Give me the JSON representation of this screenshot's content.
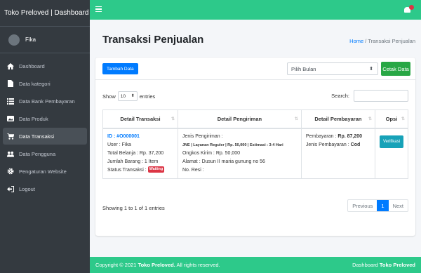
{
  "sidebar": {
    "brand": "Toko Preloved | Dashboard",
    "user_name": "Fika",
    "items": [
      {
        "label": "Dashboard",
        "icon": "home-icon"
      },
      {
        "label": "Data kategori",
        "icon": "file-icon"
      },
      {
        "label": "Data Bank Pembayaran",
        "icon": "list-icon"
      },
      {
        "label": "Data Produk",
        "icon": "image-icon"
      },
      {
        "label": "Data Transaksi",
        "icon": "cart-icon"
      },
      {
        "label": "Data Pengguna",
        "icon": "users-icon"
      },
      {
        "label": "Pengaturan Website",
        "icon": "gear-icon"
      },
      {
        "label": "Logout",
        "icon": "logout-icon"
      }
    ]
  },
  "header": {
    "accent": "#2dc98a"
  },
  "page": {
    "title": "Transaksi Penjualan",
    "breadcrumb_home": "Home",
    "breadcrumb_sep": "/",
    "breadcrumb_current": "Transaksi Penjualan"
  },
  "toolbar": {
    "add_label": "Tambah Data",
    "month_select": "Pilih Bulan",
    "print_label": "Cetak Data"
  },
  "table_controls": {
    "show_label": "Show",
    "entries_value": "10",
    "entries_label": "entries",
    "search_label": "Search:"
  },
  "table": {
    "headers": [
      "Detail Transaksi",
      "Detail Pengiriman",
      "Detail Pembayaran",
      "Opsi"
    ],
    "rows": [
      {
        "id": "ID : #O000001",
        "user": "User : Fika",
        "total": "Total Belanja : Rp. 37,200",
        "qty": "Jumlah Barang : 1 Item",
        "status_label": "Status Transaksi :",
        "status_badge": "Waiting",
        "ship_title": "Jenis Pengiriman :",
        "ship_detail": "JNE | Layanan Reguler | Rp. 50,000 | Estimasi : 3-4 Hari",
        "ship_cost": "Ongkos Kirim : Rp. 50,000",
        "address": "Alamat : Dusun II maria gunung no 56",
        "receipt": "No. Resi :",
        "pay_label": "Pembayaran :",
        "pay_amount": "Rp. 87,200",
        "pay_type_label": "Jenis Pembayaran :",
        "pay_type": "Cod",
        "verify_label": "Verifikasi"
      }
    ]
  },
  "pagination": {
    "info": "Showing 1 to 1 of 1 entries",
    "previous": "Previous",
    "current": "1",
    "next": "Next"
  },
  "footer": {
    "copyright": "Copyright © 2021",
    "brand": "Toko Preloved.",
    "rights": "All rights reserved.",
    "right_prefix": "Dashboard",
    "right_brand": "Toko Preloved"
  }
}
